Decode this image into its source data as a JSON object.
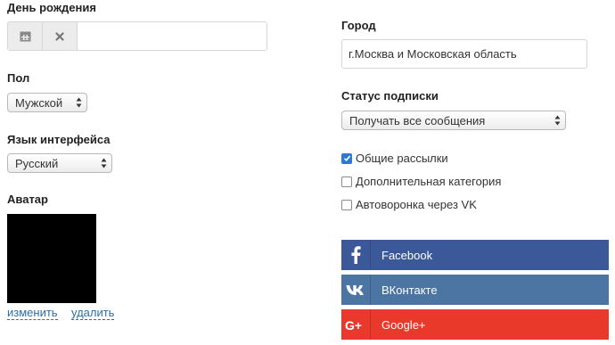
{
  "birthday": {
    "label": "День рождения",
    "value": "",
    "calendar_icon": "calendar-icon",
    "clear_icon": "close-icon"
  },
  "gender": {
    "label": "Пол",
    "selected": "Мужской"
  },
  "language": {
    "label": "Язык интерфейса",
    "selected": "Русский"
  },
  "avatar": {
    "label": "Аватар",
    "change_link": "изменить",
    "delete_link": "удалить"
  },
  "city": {
    "label": "Город",
    "value": "г.Москва и Московская область"
  },
  "subscription": {
    "label": "Статус подписки",
    "selected": "Получать все сообщения",
    "lists": [
      {
        "label": "Общие рассылки",
        "checked": true
      },
      {
        "label": "Дополнительная категория",
        "checked": false
      },
      {
        "label": "Автоворонка через VK",
        "checked": false
      }
    ]
  },
  "social": [
    {
      "label": "Facebook",
      "icon": "facebook-icon",
      "color": "#3b5998"
    },
    {
      "label": "ВКонтакте",
      "icon": "vk-icon",
      "color": "#4c75a3"
    },
    {
      "label": "Google+",
      "icon": "google-plus-icon",
      "color": "#e8392a"
    }
  ]
}
